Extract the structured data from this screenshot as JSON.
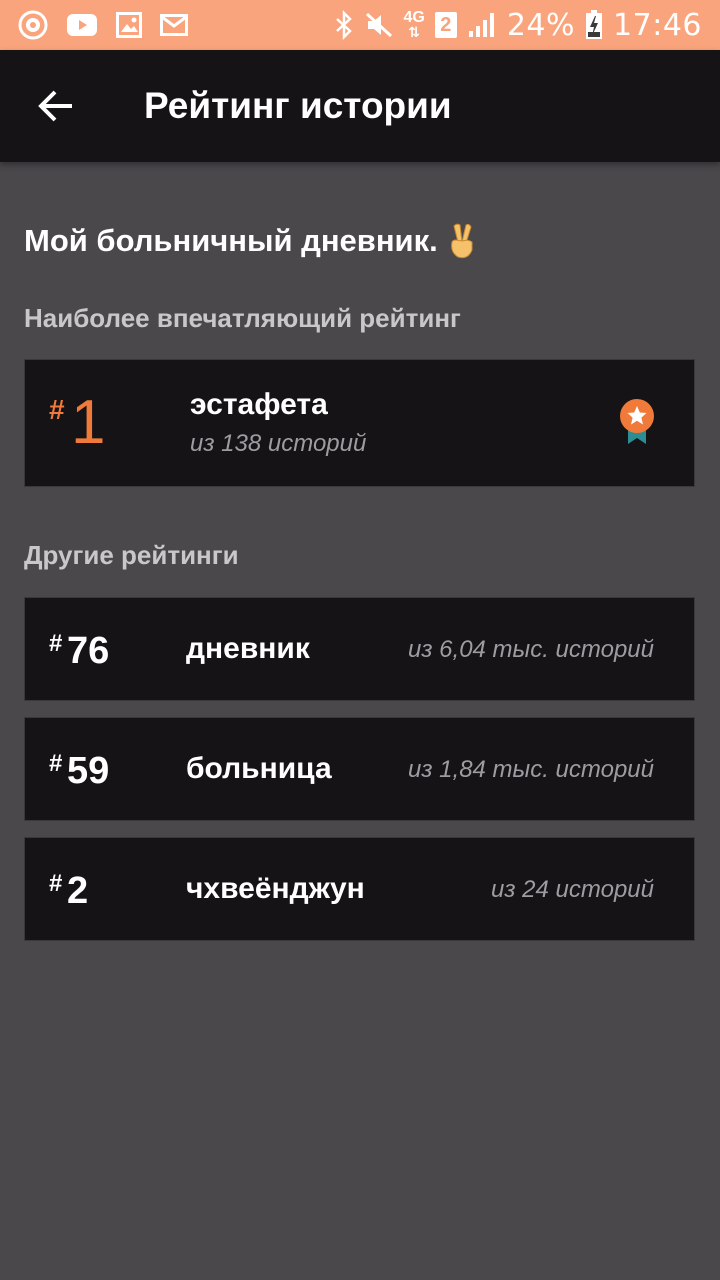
{
  "status_bar": {
    "battery": "24%",
    "time": "17:46",
    "network": "4G",
    "sim": "2",
    "bg_color": "#f9a47c",
    "icons": [
      "music-app-icon",
      "youtube-icon",
      "gallery-icon",
      "gmail-icon",
      "bluetooth-icon",
      "mute-icon",
      "signal-icon",
      "battery-charging-icon"
    ]
  },
  "app_bar": {
    "title": "Рейтинг истории",
    "back_icon": "arrow-left-icon"
  },
  "story": {
    "title": "Мой больничный дневник."
  },
  "top_section": {
    "label": "Наиболее впечатляющий рейтинг",
    "item": {
      "hash": "#",
      "rank": "1",
      "tag": "эстафета",
      "count": "из 138 историй",
      "badge_icon": "medal-star-icon",
      "accent": "#f07a3a"
    }
  },
  "other_section": {
    "label": "Другие рейтинги",
    "items": [
      {
        "hash": "#",
        "rank": "76",
        "tag": "дневник",
        "count": "из 6,04 тыс. историй"
      },
      {
        "hash": "#",
        "rank": "59",
        "tag": "больница",
        "count": "из 1,84 тыс. историй"
      },
      {
        "hash": "#",
        "rank": "2",
        "tag": "чхвеёнджун",
        "count": "из 24 историй"
      }
    ]
  }
}
